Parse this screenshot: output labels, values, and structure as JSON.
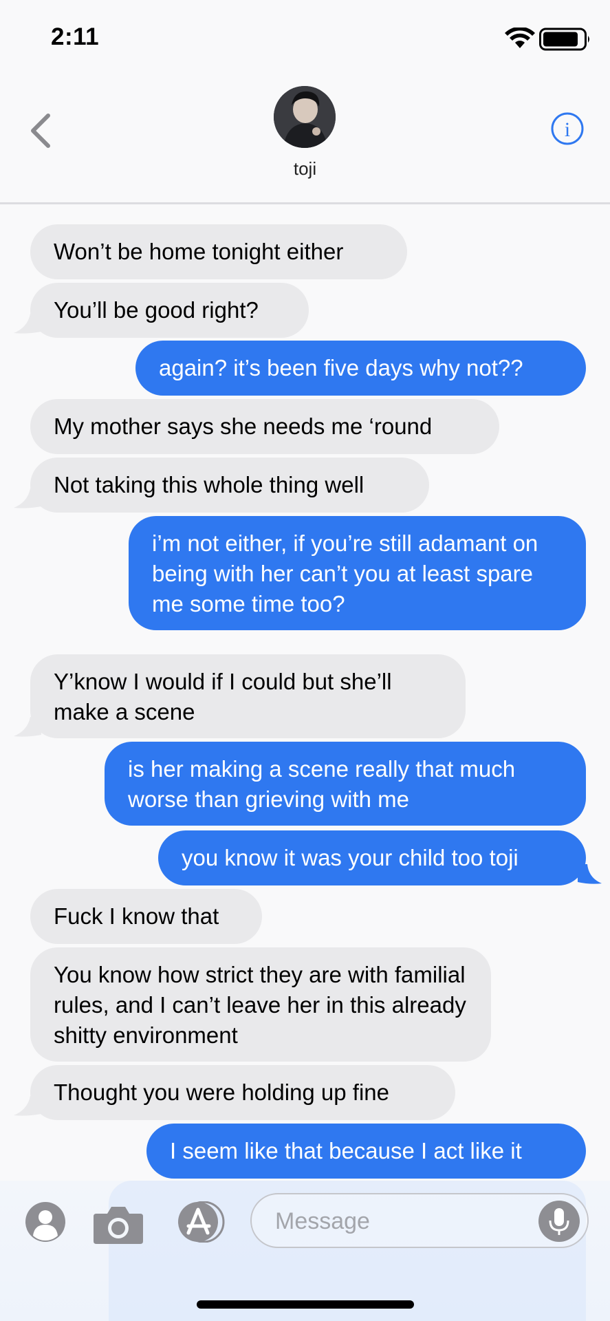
{
  "status": {
    "time": "2:11"
  },
  "header": {
    "contact_name": "toji"
  },
  "messages": [
    {
      "dir": "in",
      "text": "Won’t be home tonight either"
    },
    {
      "dir": "in",
      "text": "You’ll be good right?"
    },
    {
      "dir": "out",
      "text": "again? it’s been five days why not??"
    },
    {
      "dir": "in",
      "text": "My mother says she needs me ‘round"
    },
    {
      "dir": "in",
      "text": "Not taking this whole thing well"
    },
    {
      "dir": "out",
      "text": "i’m not either, if you’re still adamant on being with her can’t you at least spare me some time too?"
    },
    {
      "dir": "in",
      "text": "Y’know I would if I could but she’ll make a scene"
    },
    {
      "dir": "out",
      "text": "is her making a scene really that much worse than grieving with me"
    },
    {
      "dir": "out",
      "text": "you know it was your child too toji"
    },
    {
      "dir": "in",
      "text": "Fuck I know that"
    },
    {
      "dir": "in",
      "text": "You know how strict they are with familial rules, and I can’t leave her in this already shitty environment"
    },
    {
      "dir": "in",
      "text": "Thought you were holding up fine"
    },
    {
      "dir": "out",
      "text": "I seem like that because I act like it"
    }
  ],
  "composer": {
    "placeholder": "Message"
  },
  "icons": [
    "back-chevron-icon",
    "info-icon",
    "contacts-icon",
    "camera-icon",
    "app-store-icon",
    "mic-icon",
    "wifi-icon",
    "battery-icon"
  ],
  "colors": {
    "outgoing": "#2f78f0",
    "incoming": "#e9e9eb",
    "accent": "#2f78f0"
  }
}
